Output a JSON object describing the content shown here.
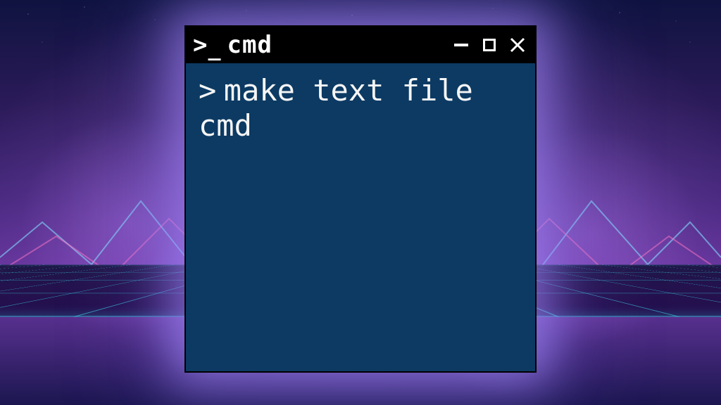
{
  "titlebar": {
    "app_icon_name": "terminal-icon",
    "app_label": "cmd"
  },
  "window_controls": {
    "minimize_name": "minimize-icon",
    "maximize_name": "maximize-icon",
    "close_name": "close-icon"
  },
  "terminal": {
    "prompt_char": ">",
    "command": "make text file cmd"
  },
  "colors": {
    "terminal_bg": "#0c3a63",
    "titlebar_bg": "#000000",
    "text": "#f5f5f5",
    "glow": "#aa8cff",
    "grid_line": "#3cf0ff"
  }
}
